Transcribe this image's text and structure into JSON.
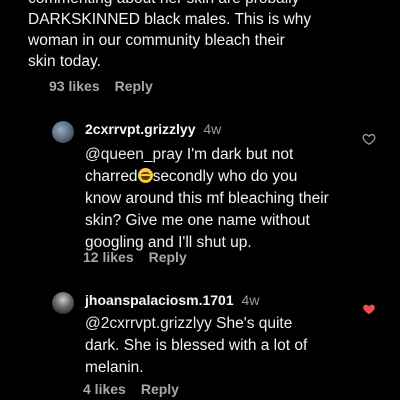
{
  "top_comment": {
    "lines": [
      "commenting about her skin are probally",
      "DARKSKINNED black males. This is why",
      "woman in our community bleach their",
      "skin today."
    ],
    "likes": "93 likes",
    "reply_label": "Reply"
  },
  "replies": [
    {
      "username": "2cxrrvpt.grizzlyy",
      "time": "4w",
      "mention": "@queen_pray",
      "lines": [
        " I'm dark but not",
        "charred",
        "secondly who do you",
        "know around this mf bleaching their",
        "skin? Give me one name without",
        "googling and I'll shut up."
      ],
      "likes": "12 likes",
      "reply_label": "Reply",
      "liked": false,
      "heart_color": "#a8a8a8"
    },
    {
      "username": "jhoanspalaciosm.1701",
      "time": "4w",
      "mention": "@2cxrrvpt.grizzlyy",
      "lines": [
        " She's quite",
        "dark. She is blessed with a lot of",
        "melanin."
      ],
      "likes": "4 likes",
      "reply_label": "Reply",
      "liked": true,
      "heart_color": "#ed4956"
    }
  ]
}
